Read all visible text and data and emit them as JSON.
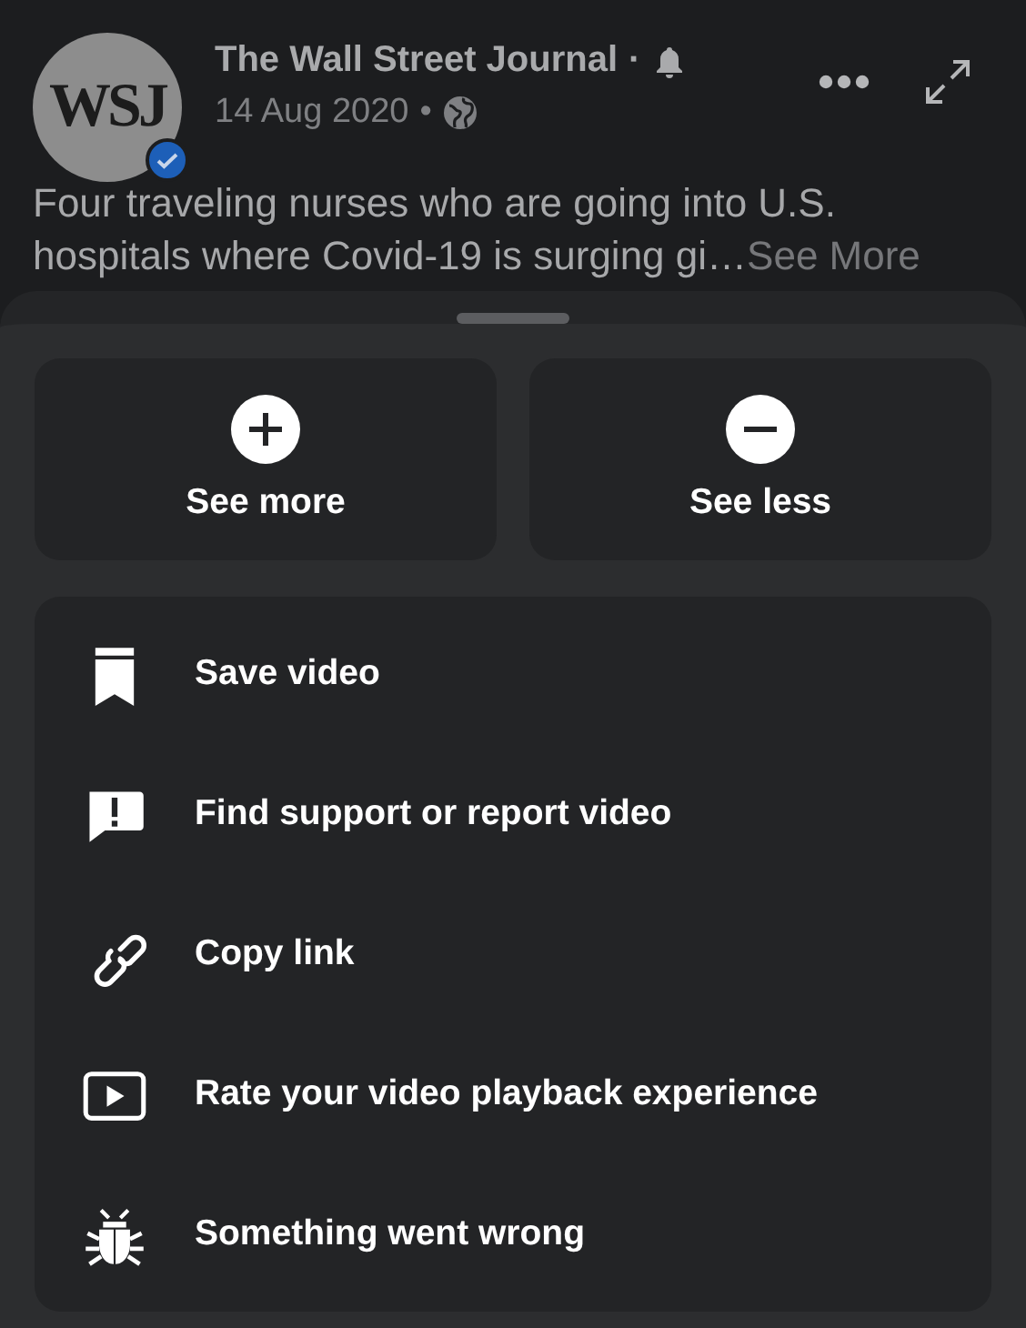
{
  "post": {
    "avatar_logo": "WSJ",
    "verified": true,
    "author": "The Wall Street Journal",
    "separator": "·",
    "date": "14 Aug 2020",
    "date_separator": "•",
    "text": "Four traveling nurses who are going into U.S. hospitals where Covid-19 is surging gi…",
    "see_more": "See More"
  },
  "sheet": {
    "feedback": [
      {
        "label": "See more"
      },
      {
        "label": "See less"
      }
    ],
    "items": [
      {
        "label": "Save video"
      },
      {
        "label": "Find support or report video"
      },
      {
        "label": "Copy link"
      },
      {
        "label": "Rate your video playback experience"
      },
      {
        "label": "Something went wrong"
      }
    ]
  }
}
